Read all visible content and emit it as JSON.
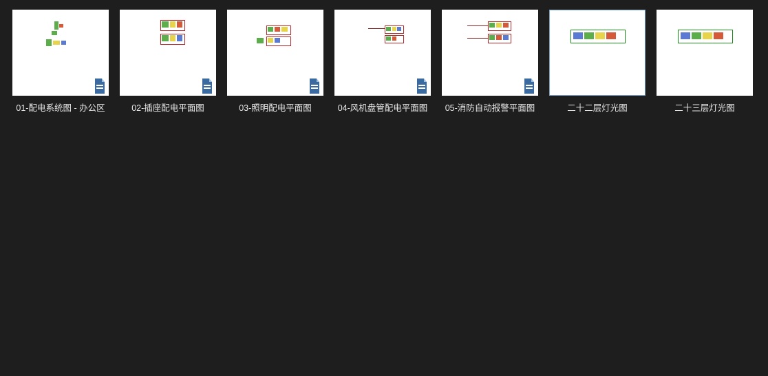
{
  "files": [
    {
      "label": "01-配电系统图 - 办公区",
      "has_dwg_icon": true,
      "selected": false,
      "preview": "p1"
    },
    {
      "label": "02-插座配电平面图",
      "has_dwg_icon": true,
      "selected": false,
      "preview": "p2"
    },
    {
      "label": "03-照明配电平面图",
      "has_dwg_icon": true,
      "selected": false,
      "preview": "p2b"
    },
    {
      "label": "04-风机盘管配电平面图",
      "has_dwg_icon": true,
      "selected": false,
      "preview": "p4"
    },
    {
      "label": "05-消防自动报警平面图",
      "has_dwg_icon": true,
      "selected": false,
      "preview": "p5"
    },
    {
      "label": "二十二层灯光图",
      "has_dwg_icon": false,
      "selected": true,
      "preview": "p6"
    },
    {
      "label": "二十三层灯光图",
      "has_dwg_icon": false,
      "selected": false,
      "preview": "p6"
    }
  ],
  "colors": {
    "bg": "#1e1e1e",
    "thumb_bg": "#ffffff",
    "selected_border": "#7aa3c9",
    "text": "#e8e8e8",
    "dwg_icon": "#3b6aa0"
  }
}
